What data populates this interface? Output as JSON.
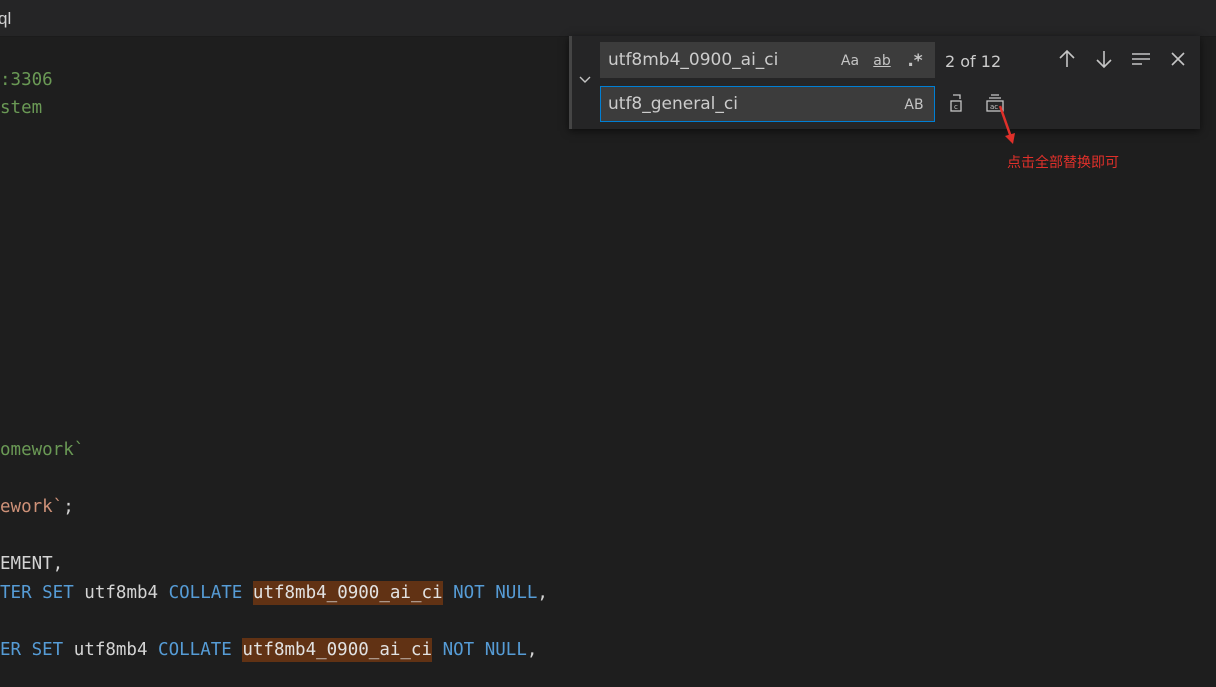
{
  "tab": {
    "title": "ql"
  },
  "code": {
    "l1": "3306",
    "l1_prefix": ":",
    "l2": "stem",
    "l3": "omework`",
    "l4_str": "ework`",
    "l4_rest": ";",
    "l5": "EMENT,",
    "l6": {
      "kw1": "TER SET",
      "t1": " utf8mb4 ",
      "kw2": "COLLATE",
      "hl": "utf8mb4_0900_ai_ci",
      "kw3": "NOT NULL",
      "end": ","
    },
    "l7": {
      "kw1": "ER SET",
      "t1": " utf8mb4 ",
      "kw2": "COLLATE",
      "hl": "utf8mb4_0900_ai_ci",
      "kw3": "NOT NULL",
      "end": ","
    }
  },
  "find_widget": {
    "find_value": "utf8mb4_0900_ai_ci",
    "replace_value": "utf8_general_ci",
    "match_case_label": "Aa",
    "whole_word_label": "ab",
    "regex_label": ".*",
    "preserve_case_label": "AB",
    "match_count": "2 of 12"
  },
  "annotation": {
    "text": "点击全部替换即可"
  },
  "colors": {
    "background": "#1e1e1e",
    "keyword": "#569cd6",
    "string": "#ce9178",
    "comment_green": "#6a9955",
    "highlight": "#613214",
    "focus_border": "#007fd4",
    "annotation": "#e0302a"
  },
  "icons": [
    "chevron-down-icon",
    "arrow-up-icon",
    "arrow-down-icon",
    "selection-icon",
    "close-icon",
    "replace-icon",
    "replace-all-icon"
  ]
}
